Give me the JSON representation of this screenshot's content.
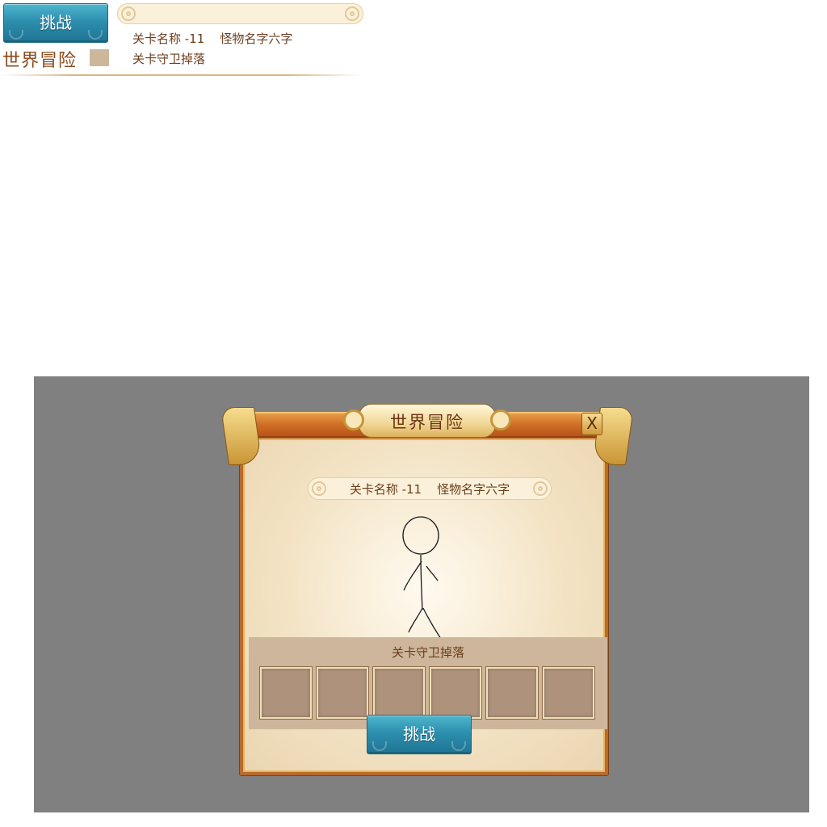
{
  "sheet": {
    "challenge_label": "挑战",
    "stage_line": "关卡名称 -11    怪物名字六字",
    "drop_label": "关卡守卫掉落",
    "title": "世界冒险"
  },
  "dialog": {
    "title": "世界冒险",
    "close_label": "X",
    "stage_line": "关卡名称 -11    怪物名字六字",
    "drop_label": "关卡守卫掉落",
    "drop_slots": [
      "",
      "",
      "",
      "",
      "",
      ""
    ],
    "challenge_label": "挑战"
  },
  "colors": {
    "overlay": "#808080",
    "button_teal": "#2d8fae",
    "title_bar_orange": "#cf6e25",
    "panel_tan": "#cdb69b",
    "slot_fill": "#ae927b",
    "text_brown": "#6b3d1c"
  }
}
